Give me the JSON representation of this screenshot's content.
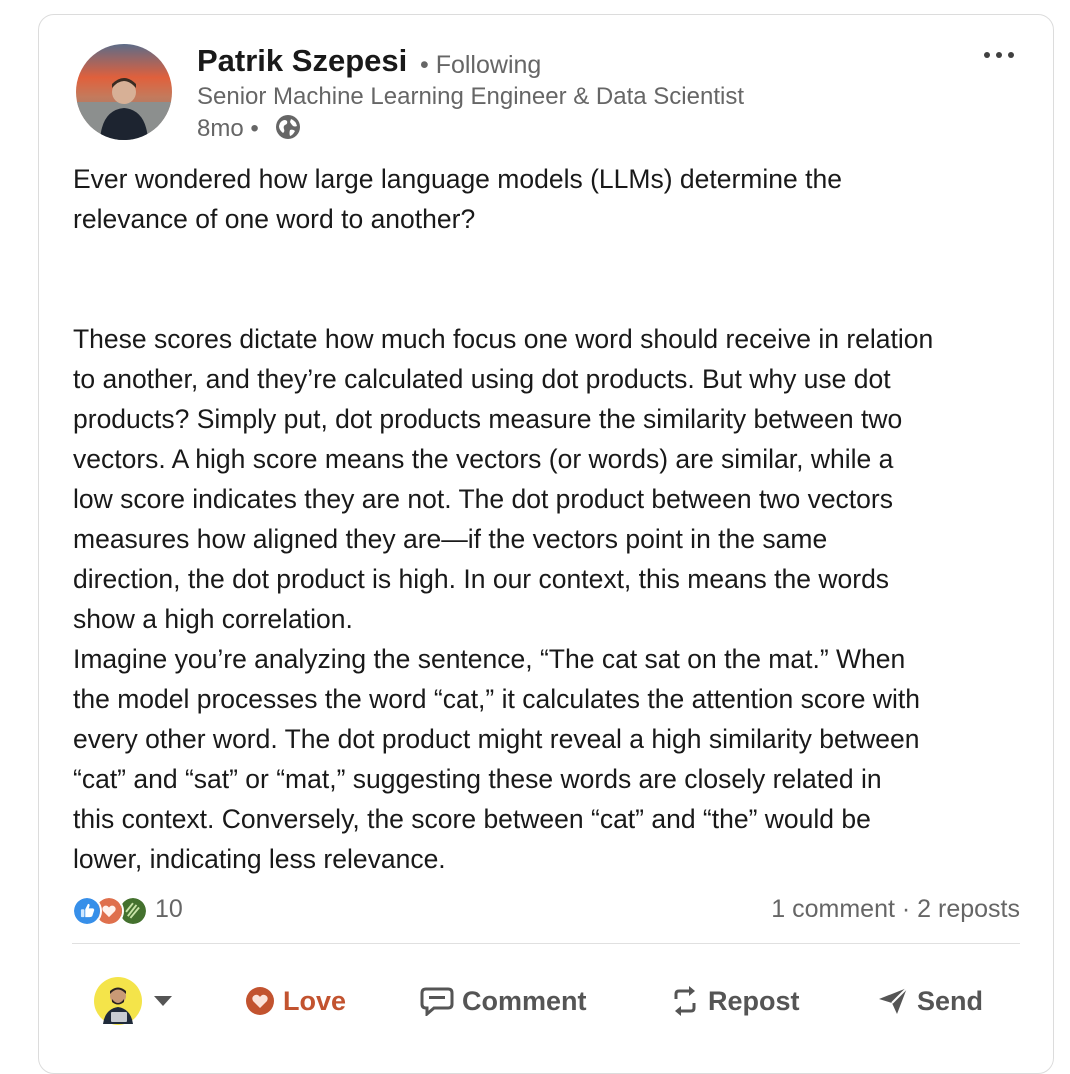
{
  "author": {
    "name": "Patrik Szepesi",
    "follow_status": "• Following",
    "headline": "Senior Machine Learning Engineer & Data Scientist",
    "timestamp": "8mo •"
  },
  "post": {
    "paragraphs": [
      [
        "Ever wondered how large language models (LLMs) determine the",
        "relevance of one word to another?"
      ],
      [
        "These scores dictate how much focus one word should receive in relation",
        "to another, and they’re calculated using dot products. But why use dot",
        "products? Simply put, dot products measure the similarity between two",
        "vectors. A high score means the vectors (or words) are similar, while a",
        "low score indicates they are not. The dot product between two vectors",
        "measures how aligned they are—if the vectors point in the same",
        "direction, the dot product is high. In our context, this means the words",
        "show a high correlation.",
        "Imagine you’re analyzing the sentence, “The cat sat on the mat.” When",
        "the model processes the word “cat,” it calculates the attention score with",
        "every other word. The dot product might reveal a high similarity between",
        "“cat” and “sat” or “mat,” suggesting these words are closely related in",
        "this context. Conversely, the score between “cat” and “the” would be",
        "lower, indicating less relevance."
      ]
    ]
  },
  "engagement": {
    "reaction_count": "10",
    "reaction_types": [
      "like-icon",
      "love-icon",
      "insightful-icon"
    ],
    "comments_reposts": "1 comment · 2 reposts"
  },
  "actions": {
    "love": "Love",
    "comment": "Comment",
    "repost": "Repost",
    "send": "Send"
  },
  "colors": {
    "love": "#c2532f",
    "like": "#378fe9",
    "insightful": "#44712e"
  }
}
